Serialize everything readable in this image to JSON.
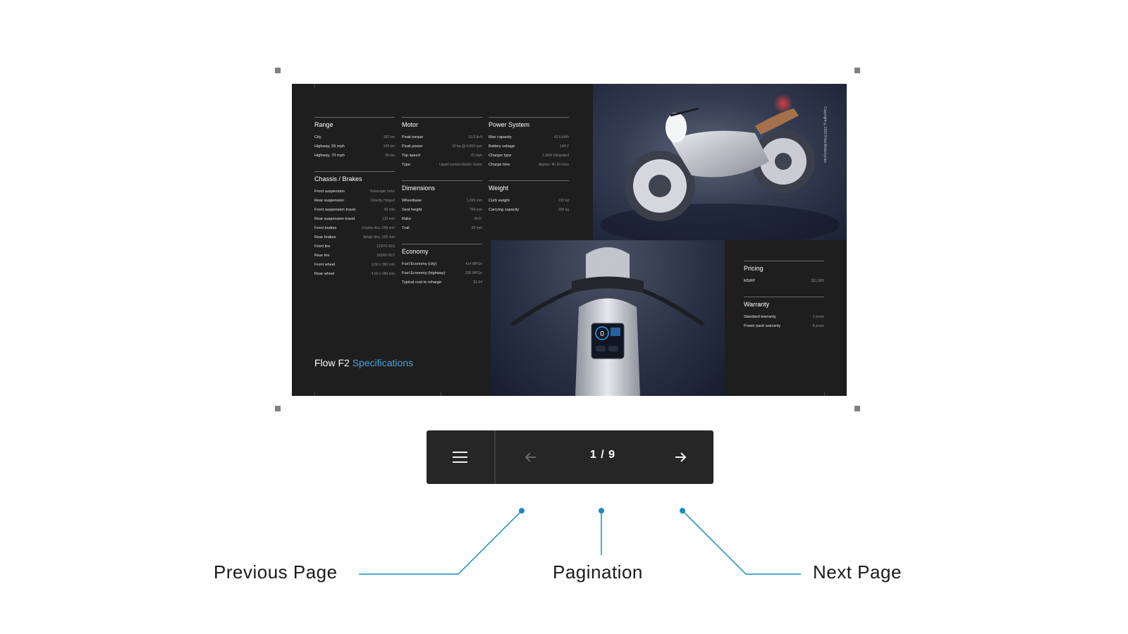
{
  "document": {
    "copyright": "Copyright ©2022 Flow Motorcycles",
    "title_prefix": "Flow F2",
    "title_accent": "Specifications",
    "accent_color": "#4aa3df",
    "columns": [
      [
        {
          "title": "Range",
          "rows": [
            {
              "label": "City",
              "value": "182 km"
            },
            {
              "label": "Highway, 55 mph",
              "value": "109 km"
            },
            {
              "label": "Highway, 70 mph",
              "value": "96 km"
            }
          ]
        },
        {
          "title": "Chassis / Brakes",
          "rows": [
            {
              "label": "Front suspension",
              "value": "Telescopic forks"
            },
            {
              "label": "Rear suspension",
              "value": "Directly Hinged"
            },
            {
              "label": "Front suspension travel",
              "value": "92 mm"
            },
            {
              "label": "Rear suspension travel",
              "value": "110 mm"
            },
            {
              "label": "Front brakes",
              "value": "Double disc, 265 mm"
            },
            {
              "label": "Rear brakes",
              "value": "Single disc, 265 mm"
            },
            {
              "label": "Front tire",
              "value": "120/70 R15"
            },
            {
              "label": "Rear tire",
              "value": "160/60 R15"
            },
            {
              "label": "Front wheel",
              "value": "3.50 x 380 mm"
            },
            {
              "label": "Rear wheel",
              "value": "4.50 x 380 mm"
            }
          ]
        }
      ],
      [
        {
          "title": "Motor",
          "rows": [
            {
              "label": "Peak torque",
              "value": "53.8 lb-ft"
            },
            {
              "label": "Peak power",
              "value": "42 hp @ 6,800 rpm"
            },
            {
              "label": "Top speed",
              "value": "75 mph"
            },
            {
              "label": "Type",
              "value": "Liquid-cooled electric motor"
            }
          ]
        },
        {
          "title": "Dimensions",
          "rows": [
            {
              "label": "Wheelbase",
              "value": "1,396 mm"
            },
            {
              "label": "Seat height",
              "value": "764 mm"
            },
            {
              "label": "Rake",
              "value": "24.5°"
            },
            {
              "label": "Trail",
              "value": "92 mm"
            }
          ]
        },
        {
          "title": "Economy",
          "rows": [
            {
              "label": "Fuel Economy (city)",
              "value": "414 MPGe"
            },
            {
              "label": "Fuel Economy (highway)",
              "value": "206 MPGe"
            },
            {
              "label": "Typical cost to reharge",
              "value": "$1.94"
            }
          ]
        }
      ],
      [
        {
          "title": "Power System",
          "rows": [
            {
              "label": "Max capacity",
              "value": "42.6 kWh"
            },
            {
              "label": "Battery voltage",
              "value": "144 V"
            },
            {
              "label": "Charger type",
              "value": "1.2kW Integrated"
            },
            {
              "label": "Charge time",
              "value": "Approx. 4h 20 mins"
            }
          ]
        },
        {
          "title": "Weight",
          "rows": [
            {
              "label": "Curb weight",
              "value": "220 kg"
            },
            {
              "label": "Carrying capacity",
              "value": "200 kg"
            }
          ]
        }
      ]
    ],
    "side_panel": [
      {
        "title": "Pricing",
        "rows": [
          {
            "label": "MSRP",
            "value": "$21,995"
          }
        ]
      },
      {
        "title": "Warranty",
        "rows": [
          {
            "label": "Standard warranty",
            "value": "2 years"
          },
          {
            "label": "Power pack warranty",
            "value": "8 years"
          }
        ]
      }
    ],
    "dash_speed": "0"
  },
  "navbar": {
    "menu_icon": "hamburger-menu-icon",
    "prev_icon": "arrow-left-icon",
    "next_icon": "arrow-right-icon",
    "page_indicator": "1 / 9"
  },
  "callouts": {
    "previous": "Previous Page",
    "pagination": "Pagination",
    "next": "Next Page",
    "line_color": "#1a8ac4"
  }
}
